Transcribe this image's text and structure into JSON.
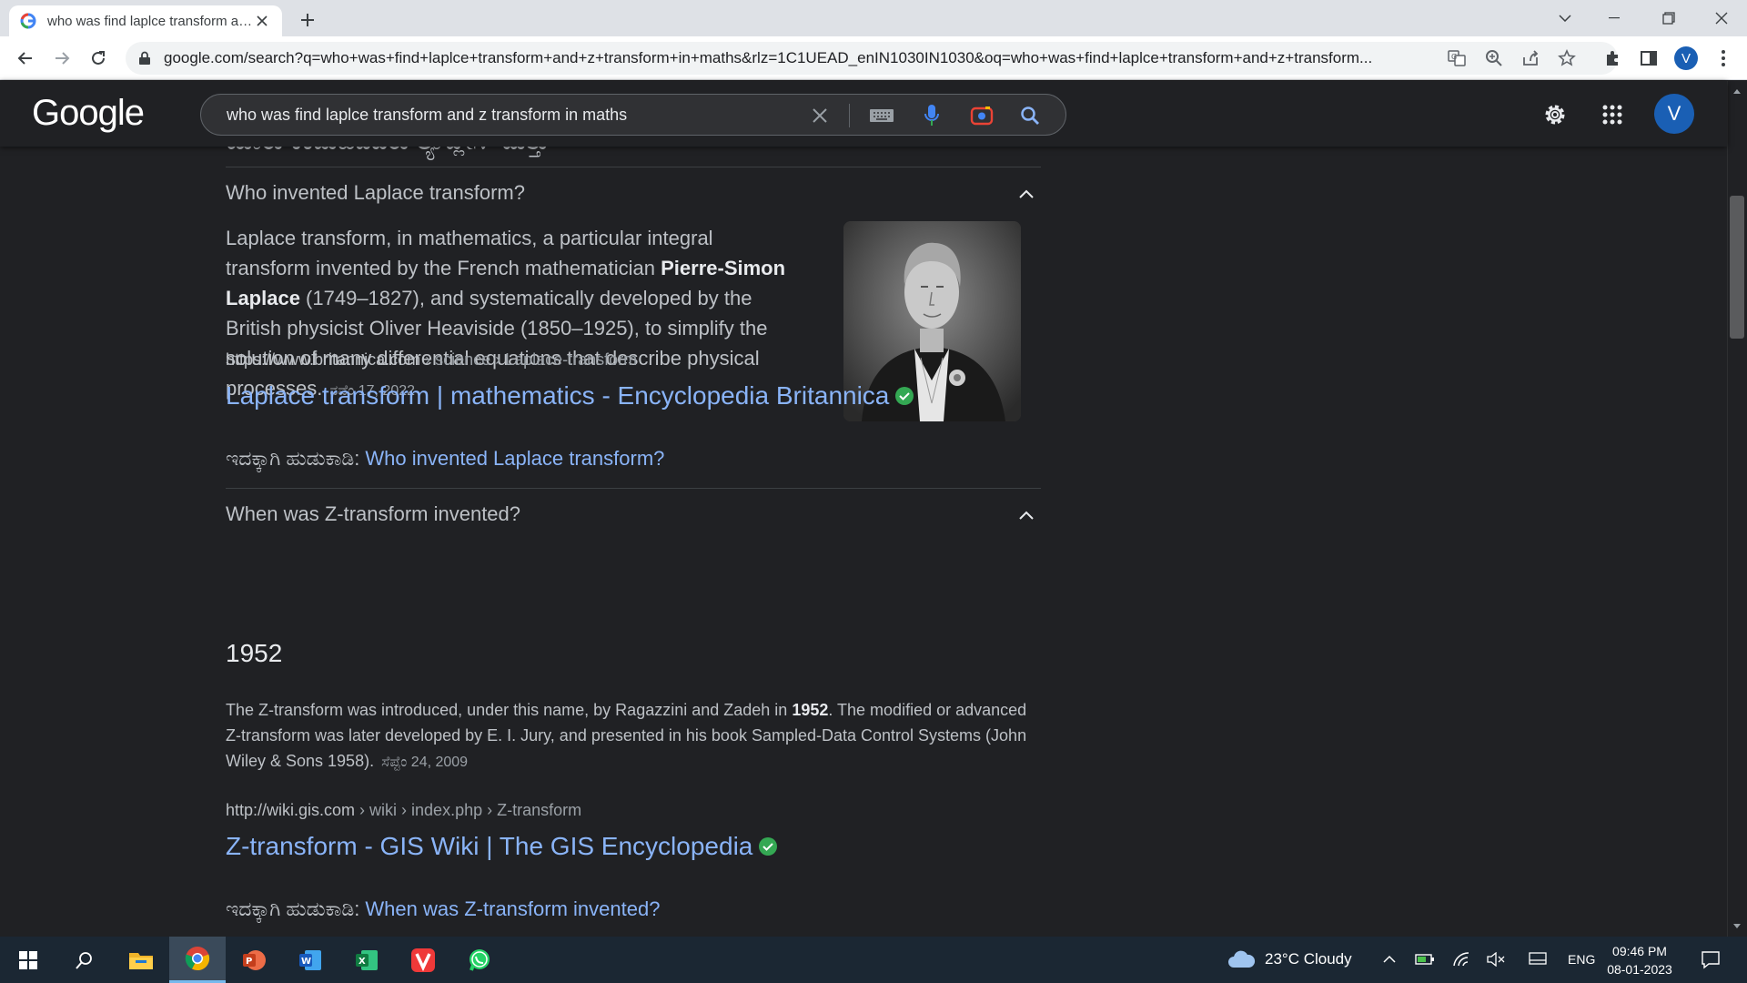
{
  "browser": {
    "tab": {
      "title": "who was find laplce transform and z transform in maths",
      "favicon": "google-g-icon"
    },
    "url": "google.com/search?q=who+was+find+laplce+transform+and+z+transform+in+maths&rlz=1C1UEAD_enIN1030IN1030&oq=who+was+find+laplce+transform+and+z+transform...",
    "profile_initial": "V"
  },
  "google": {
    "logo": "Google",
    "query": "who was find laplce transform and z transform in maths",
    "avatar_initial": "V"
  },
  "results": {
    "cut_heading": "ಯಾರು ಕಂಡುಹಿಡಿದರು ಲ್ಯಾಪ್ಲೇಸ್ ಮತ್ತು",
    "q1": {
      "question": "Who invented Laplace transform?",
      "answer_pre": "Laplace transform, in mathematics, a particular integral transform invented by the French mathematician ",
      "answer_bold": "Pierre-Simon Laplace",
      "answer_post": " (1749–1827), and systematically developed by the British physicist Oliver Heaviside (1850–1925), to simplify the solution of many differential equations that describe physical processes.",
      "date": "ನವೆಂ 17, 2022",
      "cite_domain": "https://www.britannica.com",
      "cite_path": " › science › Laplace-transform",
      "link": "Laplace transform | mathematics - Encyclopedia Britannica",
      "search_prefix": "ಇದಕ್ಕಾಗಿ ಹುಡುಕಾಡಿ: ",
      "search_query": "Who invented Laplace transform?"
    },
    "q2": {
      "question": "When was Z-transform invented?",
      "short_answer": "1952",
      "snippet_pre": "The Z-transform was introduced, under this name, by Ragazzini and Zadeh in ",
      "snippet_bold": "1952",
      "snippet_post": ". The modified or advanced Z-transform was later developed by E. I. Jury, and presented in his book Sampled-Data Control Systems (John Wiley & Sons 1958).",
      "date": "ಸೆಪ್ಟೆಂ 24, 2009",
      "cite_domain": "http://wiki.gis.com",
      "cite_path": " › wiki › index.php › Z-transform",
      "link": "Z-transform - GIS Wiki | The GIS Encyclopedia",
      "search_prefix": "ಇದಕ್ಕಾಗಿ ಹುಡುಕಾಡಿ: ",
      "search_query": "When was Z-transform invented?"
    }
  },
  "taskbar": {
    "weather": "23°C  Cloudy",
    "lang": "ENG",
    "time": "09:46 PM",
    "date": "08-01-2023"
  },
  "colors": {
    "link": "#8ab4f8",
    "bg": "#202124",
    "text": "#bdc1c6",
    "verified": "#34a853"
  }
}
